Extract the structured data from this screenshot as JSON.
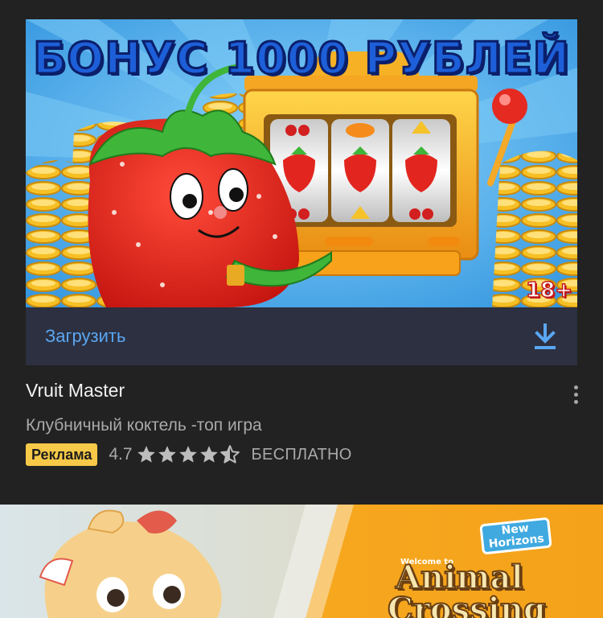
{
  "ad": {
    "banner": {
      "headline": "БОНУС 1000 РУБЛЕЙ",
      "age_rating": "18+",
      "colors": {
        "sky": "#3aa6e8",
        "ray": "#6cc4f4",
        "coin": "#f5b820",
        "strawberry": "#e52a22",
        "leaf": "#3fb53a",
        "machine": "#f5a623"
      }
    },
    "install": {
      "label": "Загрузить",
      "icon": "download-icon"
    },
    "title": "Vruit Master",
    "subtitle": "Клубничный коктель -топ игра",
    "badge": "Реклама",
    "rating": {
      "value": "4.7",
      "stars": 4.7,
      "max": 5
    },
    "price": "БЕСПЛАТНО",
    "menu_icon": "more-vert-icon"
  },
  "next_card": {
    "logo_small": "Welcome to",
    "logo_badge_line1": "New",
    "logo_badge_line2": "Horizons",
    "logo_line1": "Animal",
    "logo_line2": "Crossing"
  },
  "theme": {
    "background": "#222222",
    "install_bar": "#2c3040",
    "accent": "#5aa6f2",
    "ad_badge": "#f7c948"
  }
}
